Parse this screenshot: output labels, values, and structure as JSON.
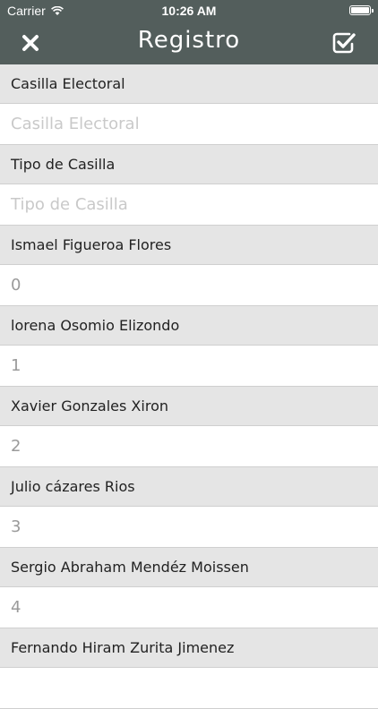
{
  "status_bar": {
    "carrier": "Carrier",
    "time": "10:26 AM"
  },
  "nav": {
    "title": "Registro"
  },
  "colors": {
    "nav_background": "#535e5c",
    "label_row_background": "#e5e5e5",
    "value_text": "#9a9a9a",
    "placeholder_text": "#c9c9c9"
  },
  "fields": [
    {
      "label": "Casilla Electoral",
      "value": "",
      "placeholder": "Casilla Electoral"
    },
    {
      "label": "Tipo de Casilla",
      "value": "",
      "placeholder": "Tipo de Casilla"
    },
    {
      "label": "Ismael Figueroa Flores",
      "value": "0",
      "placeholder": ""
    },
    {
      "label": "lorena Osomio Elizondo",
      "value": "1",
      "placeholder": ""
    },
    {
      "label": "Xavier Gonzales Xiron",
      "value": "2",
      "placeholder": ""
    },
    {
      "label": "Julio cázares Rios",
      "value": "3",
      "placeholder": ""
    },
    {
      "label": "Sergio Abraham Mendéz  Moissen",
      "value": "4",
      "placeholder": ""
    },
    {
      "label": "Fernando Hiram Zurita Jimenez",
      "value": "",
      "placeholder": ""
    }
  ]
}
